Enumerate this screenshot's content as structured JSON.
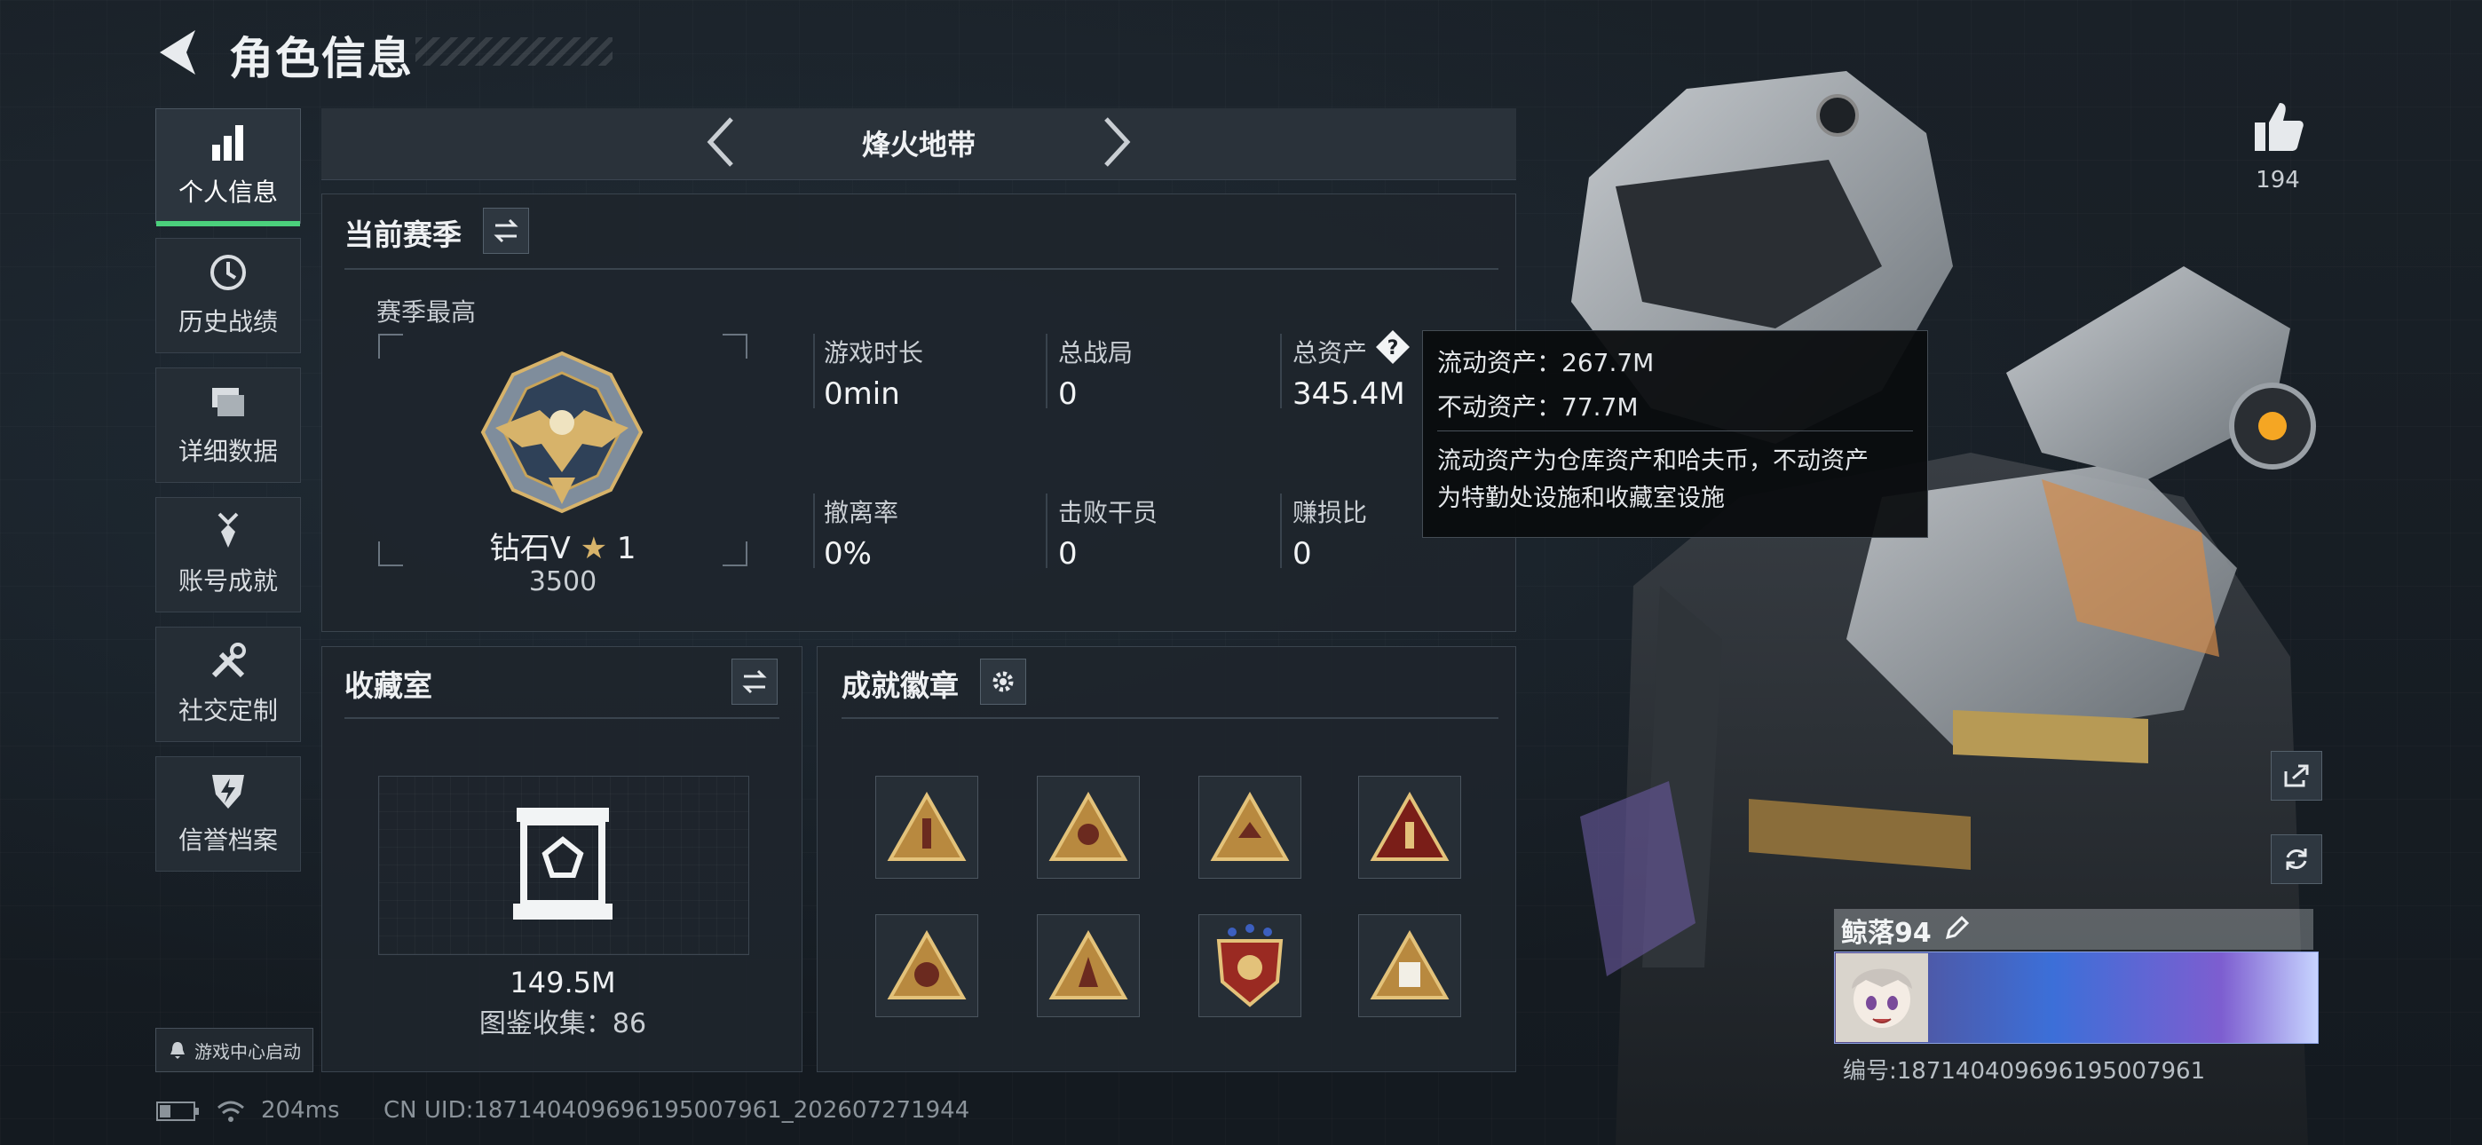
{
  "header": {
    "title": "角色信息"
  },
  "sidebar": {
    "items": [
      {
        "label": "个人信息",
        "icon": "bar-chart-icon",
        "active": true
      },
      {
        "label": "历史战绩",
        "icon": "clock-icon"
      },
      {
        "label": "详细数据",
        "icon": "folder-icon"
      },
      {
        "label": "账号成就",
        "icon": "medal-icon"
      },
      {
        "label": "社交定制",
        "icon": "tools-icon"
      },
      {
        "label": "信誉档案",
        "icon": "shield-bolt-icon"
      }
    ],
    "game_center_label": "游戏中心启动"
  },
  "mode": {
    "title": "烽火地带"
  },
  "season": {
    "title": "当前赛季",
    "best_label": "赛季最高",
    "rank_name": "钻石V",
    "rank_stars": "1",
    "rank_score": "3500",
    "stats": [
      {
        "label": "游戏时长",
        "value": "0min"
      },
      {
        "label": "总战局",
        "value": "0"
      },
      {
        "label": "总资产",
        "value": "345.4M"
      },
      {
        "label": "撤离率",
        "value": "0%"
      },
      {
        "label": "击败干员",
        "value": "0"
      },
      {
        "label": "赚损比",
        "value": "0"
      }
    ]
  },
  "tooltip": {
    "liquid": "流动资产：267.7M",
    "fixed": "不动资产：77.7M",
    "desc1": "流动资产为仓库资产和哈夫币，不动资产",
    "desc2": "为特勤处设施和收藏室设施"
  },
  "collection": {
    "title": "收藏室",
    "value": "149.5M",
    "count_text": "图鉴收集：86"
  },
  "achievements": {
    "title": "成就徽章"
  },
  "likes": {
    "count": "194"
  },
  "player": {
    "name": "鲸落94",
    "id_text": "编号:18714040969619500796​1"
  },
  "status_bar": {
    "ping": "204ms",
    "uid": "CN UID:18714040969619500796​1_202607271944"
  },
  "colors": {
    "accent_green": "#4bd07c",
    "gold": "#d7b36a",
    "panel_bg": "#1e252c"
  }
}
